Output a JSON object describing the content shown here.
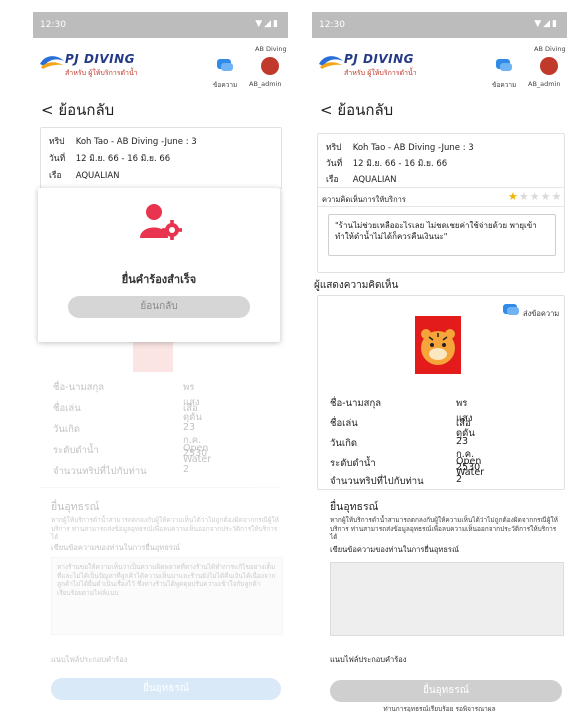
{
  "status": {
    "time": "12:30",
    "icons": "▼◢▮"
  },
  "header": {
    "brand": "PJ DIVING",
    "brand_sub": "สำหรับ ผู้ให้บริการดำน้ำ",
    "shop_name": "AB Diving",
    "message_label": "ข้อความ",
    "role_label": "AB_admin"
  },
  "back_label": "< ย้อนกลับ",
  "trip": {
    "trip_key": "ทริป",
    "trip_value": "Koh Tao - AB Diving -June : 3",
    "date_key": "วันที่",
    "date_value": "12 มิ.ย. 66 - 16 มิ.ย. 66",
    "boat_key": "เรือ",
    "boat_value": "AQUALIAN"
  },
  "review": {
    "label": "ความคิดเห็นการให้บริการ",
    "rating": 1,
    "max_rating": 5,
    "comment": "\"ร้านไม่ช่วยเหลืออะไรเลย ไม่ชดเชยค่าใช้จ่ายด้วย พายุเข้าทำให้ดำน้ำไม่ได้ก็ควรคืนเงินนะ\""
  },
  "reviewer": {
    "section_title": "ผู้แสดงความคิดเห็น",
    "send_message": "ส่งข้อความ",
    "fields": [
      {
        "key": "ชื่อ-นามสกุล",
        "value": "พรแสง ดุดัน"
      },
      {
        "key": "ชื่อเล่น",
        "value": "เสือ"
      },
      {
        "key": "วันเกิด",
        "value": "23 ก.ค. 2530"
      },
      {
        "key": "ระดับดำน้ำ",
        "value": "Open Water"
      },
      {
        "key": "จำนวนทริปที่ไปกับท่าน",
        "value": "2"
      }
    ]
  },
  "appeal": {
    "title": "ยื่นอุทธรณ์",
    "desc": "หากผู้ให้บริการดำน้ำสามารถตกลงกับผู้ให้ความเห็นได้ว่าไม่ถูกต้องผิดจากกรณีผู้ให้บริการ ท่านสามารถส่งข้อมูลอุทธรณ์เพื่อลบความเห็นออกจากประวัติการให้บริการได้",
    "write_label": "เขียนข้อความของท่านในการยื่นอุทธรณ์",
    "text_value_left": "ทางร้านขอให้ความเห็นว่าเป็นความผิดพลาดที่ทางร้านได้ทำการแก้ไขอย่างเต็มที่และไม่ได้เป็นปัญหาที่ลูกค้าได้ความเห็นมาและร้านยังไม่ได้คืนเงินได้เนื่องจากลูกค้าไม่ได้ยื่นดำเนินเรื่องไว้ ซึ่งทางร้านได้พูดคุยปรับความเข้าใจกับลูกค้าเรียบร้อยตามไฟล์แนบ",
    "attach_label": "แนบไฟล์ประกอบคำร้อง",
    "submit_label": "ยื่นอุทธรณ์",
    "status_note": "ท่านการอุทธรณ์เรียบร้อย รอพิจารณาผล"
  },
  "modal": {
    "title": "ยื่นคำร้องสำเร็จ",
    "button": "ย้อนกลับ"
  },
  "colors": {
    "brand_blue": "#243a86",
    "accent_red": "#e8344e",
    "star": "#f0b400",
    "status_gray": "#bcbcbc"
  }
}
